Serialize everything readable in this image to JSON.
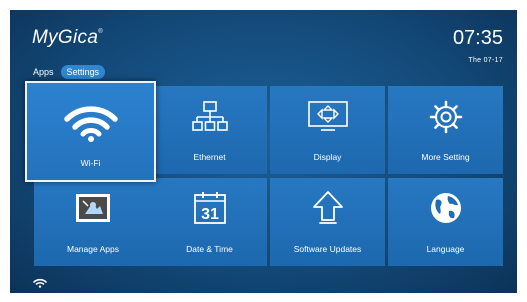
{
  "brand": {
    "logo": "MyGica",
    "mark": "®"
  },
  "tabs": [
    {
      "label": "Apps"
    },
    {
      "label": "Settings"
    }
  ],
  "clock": {
    "time": "07:35",
    "date": "The 07-17"
  },
  "tiles": [
    {
      "label": "Wi-Fi",
      "icon": "wifi-icon",
      "focused": true
    },
    {
      "label": "Ethernet",
      "icon": "ethernet-icon"
    },
    {
      "label": "Display",
      "icon": "display-icon"
    },
    {
      "label": "More Setting",
      "icon": "gear-icon"
    },
    {
      "label": "Manage Apps",
      "icon": "manage-apps-icon"
    },
    {
      "label": "Date & Time",
      "icon": "calendar-icon",
      "icon_text": "31"
    },
    {
      "label": "Software Updates",
      "icon": "update-arrow-icon"
    },
    {
      "label": "Language",
      "icon": "globe-icon"
    }
  ],
  "status_bar": {
    "icon": "wifi-status-icon"
  },
  "colors": {
    "background": "#134a7a",
    "tile": "#2270b8",
    "active_tab": "#2f86d3",
    "text": "#ffffff"
  }
}
